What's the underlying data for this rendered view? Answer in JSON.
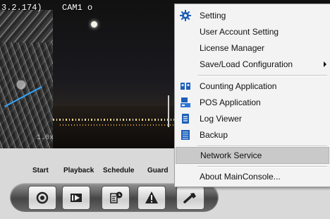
{
  "video": {
    "ip_fragment": "3.2.174)",
    "camera_name": "CAM1 o",
    "zoom": "1.0x"
  },
  "toolbar": {
    "labels": [
      "Start",
      "Playback",
      "Schedule",
      "Guard"
    ],
    "buttons": [
      {
        "icon": "record-icon"
      },
      {
        "icon": "playback-icon"
      },
      {
        "icon": "schedule-icon"
      },
      {
        "icon": "guard-warning-icon"
      },
      {
        "icon": "tools-wrench-icon"
      }
    ]
  },
  "menu": {
    "items": [
      {
        "label": "Setting",
        "icon": "gear-icon"
      },
      {
        "label": "User Account Setting"
      },
      {
        "label": "License Manager"
      },
      {
        "label": "Save/Load Configuration",
        "submenu": true
      },
      {
        "label": "Counting Application",
        "icon": "counting-icon"
      },
      {
        "label": "POS Application",
        "icon": "pos-icon"
      },
      {
        "label": "Log Viewer",
        "icon": "log-viewer-icon"
      },
      {
        "label": "Backup",
        "icon": "backup-icon"
      },
      {
        "label": "Network Service",
        "highlighted": true
      },
      {
        "label": "About MainConsole..."
      }
    ],
    "highlight_color": "#c9c9c9",
    "icon_color": "#1e5fb8"
  }
}
